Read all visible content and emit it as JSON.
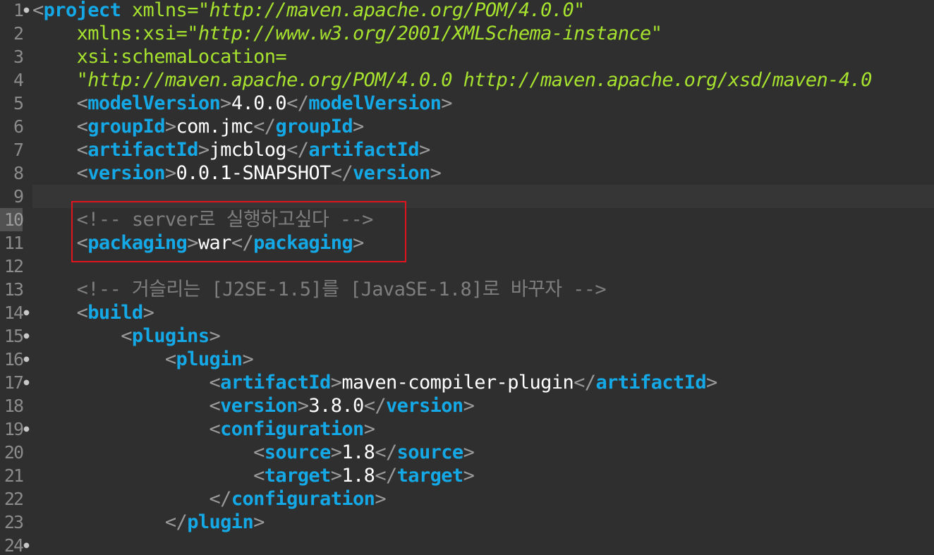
{
  "editor": {
    "active_line": "10",
    "lines": [
      {
        "num": "1",
        "fold": true,
        "indent": "",
        "segments": [
          {
            "t": "br",
            "s": "<"
          },
          {
            "t": "tag",
            "s": "project"
          },
          {
            "t": "txt",
            "s": " "
          },
          {
            "t": "attr",
            "s": "xmlns"
          },
          {
            "t": "eq",
            "s": "="
          },
          {
            "t": "val",
            "s": "\"http://maven.apache.org/POM/4.0.0\""
          }
        ]
      },
      {
        "num": "2",
        "fold": false,
        "indent": "    ",
        "segments": [
          {
            "t": "attr",
            "s": "xmlns:xsi"
          },
          {
            "t": "eq",
            "s": "="
          },
          {
            "t": "val",
            "s": "\"http://www.w3.org/2001/XMLSchema-instance\""
          }
        ]
      },
      {
        "num": "3",
        "fold": false,
        "indent": "    ",
        "segments": [
          {
            "t": "attr",
            "s": "xsi:schemaLocation"
          },
          {
            "t": "eq",
            "s": "="
          }
        ]
      },
      {
        "num": "4",
        "fold": false,
        "indent": "    ",
        "segments": [
          {
            "t": "val",
            "s": "\"http://maven.apache.org/POM/4.0.0 http://maven.apache.org/xsd/maven-4.0"
          }
        ]
      },
      {
        "num": "5",
        "fold": false,
        "indent": "    ",
        "segments": [
          {
            "t": "br",
            "s": "<"
          },
          {
            "t": "tag",
            "s": "modelVersion"
          },
          {
            "t": "br",
            "s": ">"
          },
          {
            "t": "txt",
            "s": "4.0.0"
          },
          {
            "t": "br",
            "s": "</"
          },
          {
            "t": "tag",
            "s": "modelVersion"
          },
          {
            "t": "br",
            "s": ">"
          }
        ]
      },
      {
        "num": "6",
        "fold": false,
        "indent": "    ",
        "segments": [
          {
            "t": "br",
            "s": "<"
          },
          {
            "t": "tag",
            "s": "groupId"
          },
          {
            "t": "br",
            "s": ">"
          },
          {
            "t": "txt",
            "s": "com.jmc"
          },
          {
            "t": "br",
            "s": "</"
          },
          {
            "t": "tag",
            "s": "groupId"
          },
          {
            "t": "br",
            "s": ">"
          }
        ]
      },
      {
        "num": "7",
        "fold": false,
        "indent": "    ",
        "segments": [
          {
            "t": "br",
            "s": "<"
          },
          {
            "t": "tag",
            "s": "artifactId"
          },
          {
            "t": "br",
            "s": ">"
          },
          {
            "t": "txt",
            "s": "jmcblog"
          },
          {
            "t": "br",
            "s": "</"
          },
          {
            "t": "tag",
            "s": "artifactId"
          },
          {
            "t": "br",
            "s": ">"
          }
        ]
      },
      {
        "num": "8",
        "fold": false,
        "indent": "    ",
        "segments": [
          {
            "t": "br",
            "s": "<"
          },
          {
            "t": "tag",
            "s": "version"
          },
          {
            "t": "br",
            "s": ">"
          },
          {
            "t": "txt",
            "s": "0.0.1-SNAPSHOT"
          },
          {
            "t": "br",
            "s": "</"
          },
          {
            "t": "tag",
            "s": "version"
          },
          {
            "t": "br",
            "s": ">"
          }
        ]
      },
      {
        "num": "9",
        "fold": false,
        "indent": "",
        "segments": []
      },
      {
        "num": "10",
        "fold": false,
        "indent": "    ",
        "segments": [
          {
            "t": "cm",
            "s": "<!-- server로 실행하고싶다 -->"
          }
        ]
      },
      {
        "num": "11",
        "fold": false,
        "indent": "    ",
        "segments": [
          {
            "t": "br",
            "s": "<"
          },
          {
            "t": "tag",
            "s": "packaging"
          },
          {
            "t": "br",
            "s": ">"
          },
          {
            "t": "txt",
            "s": "war"
          },
          {
            "t": "br",
            "s": "</"
          },
          {
            "t": "tag",
            "s": "packaging"
          },
          {
            "t": "br",
            "s": ">"
          }
        ]
      },
      {
        "num": "12",
        "fold": false,
        "indent": "",
        "segments": []
      },
      {
        "num": "13",
        "fold": false,
        "indent": "    ",
        "segments": [
          {
            "t": "cm",
            "s": "<!-- 거슬리는 [J2SE-1.5]를 [JavaSE-1.8]로 바꾸자 -->"
          }
        ]
      },
      {
        "num": "14",
        "fold": true,
        "indent": "    ",
        "segments": [
          {
            "t": "br",
            "s": "<"
          },
          {
            "t": "tag",
            "s": "build"
          },
          {
            "t": "br",
            "s": ">"
          }
        ]
      },
      {
        "num": "15",
        "fold": true,
        "indent": "        ",
        "segments": [
          {
            "t": "br",
            "s": "<"
          },
          {
            "t": "tag",
            "s": "plugins"
          },
          {
            "t": "br",
            "s": ">"
          }
        ]
      },
      {
        "num": "16",
        "fold": true,
        "indent": "            ",
        "segments": [
          {
            "t": "br",
            "s": "<"
          },
          {
            "t": "tag",
            "s": "plugin"
          },
          {
            "t": "br",
            "s": ">"
          }
        ]
      },
      {
        "num": "17",
        "fold": true,
        "indent": "                ",
        "segments": [
          {
            "t": "br",
            "s": "<"
          },
          {
            "t": "tag",
            "s": "artifactId"
          },
          {
            "t": "br",
            "s": ">"
          },
          {
            "t": "txt",
            "s": "maven-compiler-plugin"
          },
          {
            "t": "br",
            "s": "</"
          },
          {
            "t": "tag",
            "s": "artifactId"
          },
          {
            "t": "br",
            "s": ">"
          }
        ]
      },
      {
        "num": "18",
        "fold": false,
        "indent": "                ",
        "segments": [
          {
            "t": "br",
            "s": "<"
          },
          {
            "t": "tag",
            "s": "version"
          },
          {
            "t": "br",
            "s": ">"
          },
          {
            "t": "txt",
            "s": "3.8.0"
          },
          {
            "t": "br",
            "s": "</"
          },
          {
            "t": "tag",
            "s": "version"
          },
          {
            "t": "br",
            "s": ">"
          }
        ]
      },
      {
        "num": "19",
        "fold": true,
        "indent": "                ",
        "segments": [
          {
            "t": "br",
            "s": "<"
          },
          {
            "t": "tag",
            "s": "configuration"
          },
          {
            "t": "br",
            "s": ">"
          }
        ]
      },
      {
        "num": "20",
        "fold": false,
        "indent": "                    ",
        "segments": [
          {
            "t": "br",
            "s": "<"
          },
          {
            "t": "tag",
            "s": "source"
          },
          {
            "t": "br",
            "s": ">"
          },
          {
            "t": "txt",
            "s": "1.8"
          },
          {
            "t": "br",
            "s": "</"
          },
          {
            "t": "tag",
            "s": "source"
          },
          {
            "t": "br",
            "s": ">"
          }
        ]
      },
      {
        "num": "21",
        "fold": false,
        "indent": "                    ",
        "segments": [
          {
            "t": "br",
            "s": "<"
          },
          {
            "t": "tag",
            "s": "target"
          },
          {
            "t": "br",
            "s": ">"
          },
          {
            "t": "txt",
            "s": "1.8"
          },
          {
            "t": "br",
            "s": "</"
          },
          {
            "t": "tag",
            "s": "target"
          },
          {
            "t": "br",
            "s": ">"
          }
        ]
      },
      {
        "num": "22",
        "fold": false,
        "indent": "                ",
        "segments": [
          {
            "t": "br",
            "s": "</"
          },
          {
            "t": "tag",
            "s": "configuration"
          },
          {
            "t": "br",
            "s": ">"
          }
        ]
      },
      {
        "num": "23",
        "fold": false,
        "indent": "            ",
        "segments": [
          {
            "t": "br",
            "s": "</"
          },
          {
            "t": "tag",
            "s": "plugin"
          },
          {
            "t": "br",
            "s": ">"
          }
        ]
      },
      {
        "num": "24",
        "fold": true,
        "indent": "",
        "segments": []
      }
    ]
  }
}
